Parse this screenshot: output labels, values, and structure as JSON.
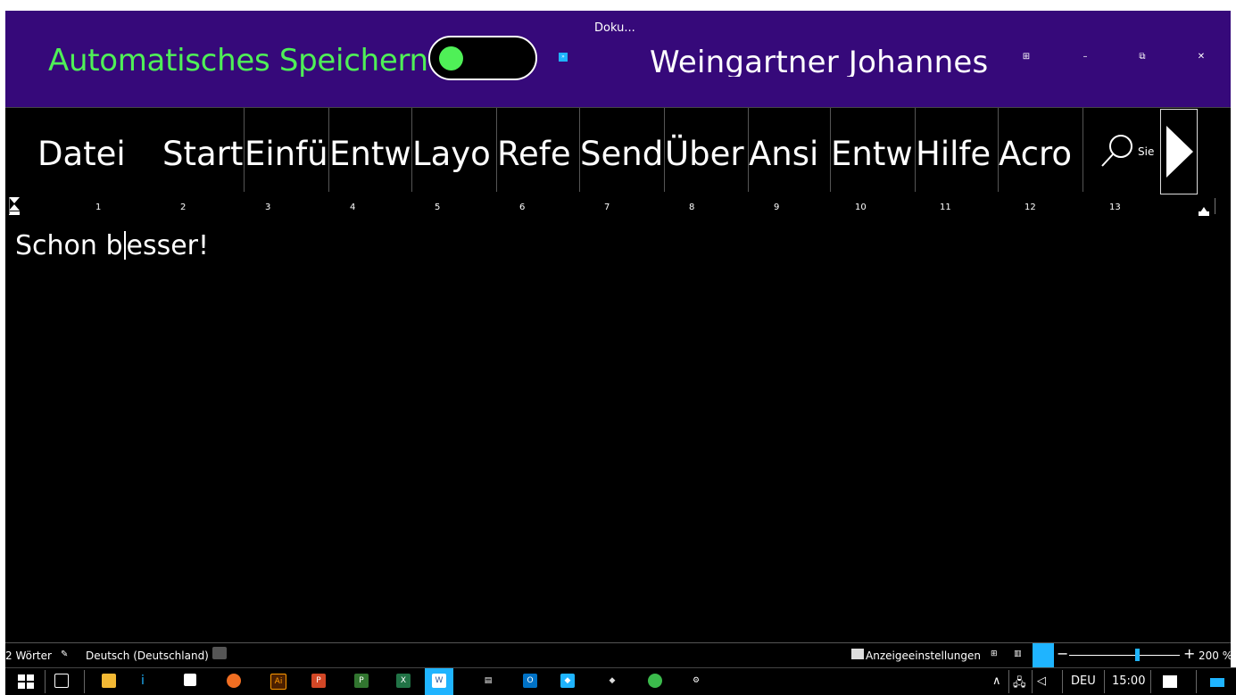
{
  "titlebar": {
    "autosave_label": "Automatisches Speichern",
    "autosave_on": true,
    "doc_title": "Doku...",
    "user_name": "Weingartner Johannes",
    "accent_color": "#36097a",
    "toggle_color": "#4ff057"
  },
  "ribbon": {
    "tabs": [
      "Datei",
      "Start",
      "Einfü",
      "Entw",
      "Layo",
      "Refe",
      "Send",
      "Über",
      "Ansi",
      "Entw",
      "Hilfe",
      "Acro"
    ],
    "search_label": "Sie",
    "more_icon": "chevron-right-icon"
  },
  "ruler": {
    "numbers": [
      "1",
      "2",
      "3",
      "4",
      "5",
      "6",
      "7",
      "8",
      "9",
      "10",
      "11",
      "12",
      "13"
    ]
  },
  "document": {
    "text_before_cursor": "Schon b",
    "text_after_cursor": "esser!"
  },
  "status": {
    "word_count": "2 Wörter",
    "language": "Deutsch (Deutschland)",
    "display_settings": "Anzeigeeinstellungen",
    "zoom": "200 %",
    "zoom_minus": "−",
    "zoom_plus": "+"
  },
  "taskbar": {
    "language": "DEU",
    "time": "15:00",
    "apps": [
      "windows-start-icon",
      "task-view-icon",
      "file-explorer-icon",
      "info-icon",
      "store-icon",
      "firefox-icon",
      "illustrator-icon",
      "powerpoint-icon",
      "project-icon",
      "excel-icon",
      "word-icon",
      "app-icon",
      "outlook-icon",
      "app-icon-2",
      "app-icon-3",
      "messaging-icon",
      "settings-icon"
    ]
  }
}
